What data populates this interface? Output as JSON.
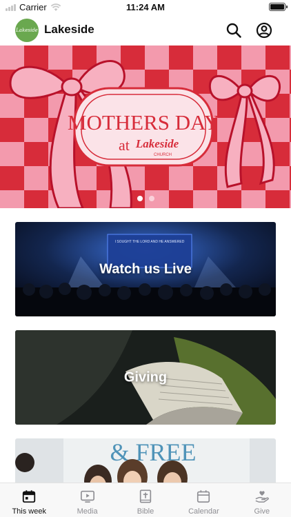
{
  "status_bar": {
    "carrier": "Carrier",
    "time": "11:24 AM"
  },
  "header": {
    "title": "Lakeside",
    "logo_text": "Lakeside"
  },
  "hero": {
    "headline": "MOTHERS DAY",
    "subline": "at",
    "brand": "Lakeside",
    "brand_sub": "CHURCH",
    "pages": 2,
    "active_page": 1
  },
  "cards": [
    {
      "label": "Watch us Live",
      "screen_text": "I SOUGHT THE LORD AND HE ANSWERED"
    },
    {
      "label": "Giving"
    },
    {
      "label": "",
      "sign_text": "& FREE"
    }
  ],
  "tabs": [
    {
      "label": "This week",
      "icon": "calendar-day-icon",
      "active": true
    },
    {
      "label": "Media",
      "icon": "play-screen-icon",
      "active": false
    },
    {
      "label": "Bible",
      "icon": "bible-icon",
      "active": false
    },
    {
      "label": "Calendar",
      "icon": "calendar-icon",
      "active": false
    },
    {
      "label": "Give",
      "icon": "give-hand-icon",
      "active": false
    }
  ],
  "colors": {
    "accent_active": "#111111",
    "inactive": "#8e8e93",
    "hero_red": "#d72c3a",
    "hero_pink": "#f39aad",
    "logo_green": "#6aa84f"
  }
}
